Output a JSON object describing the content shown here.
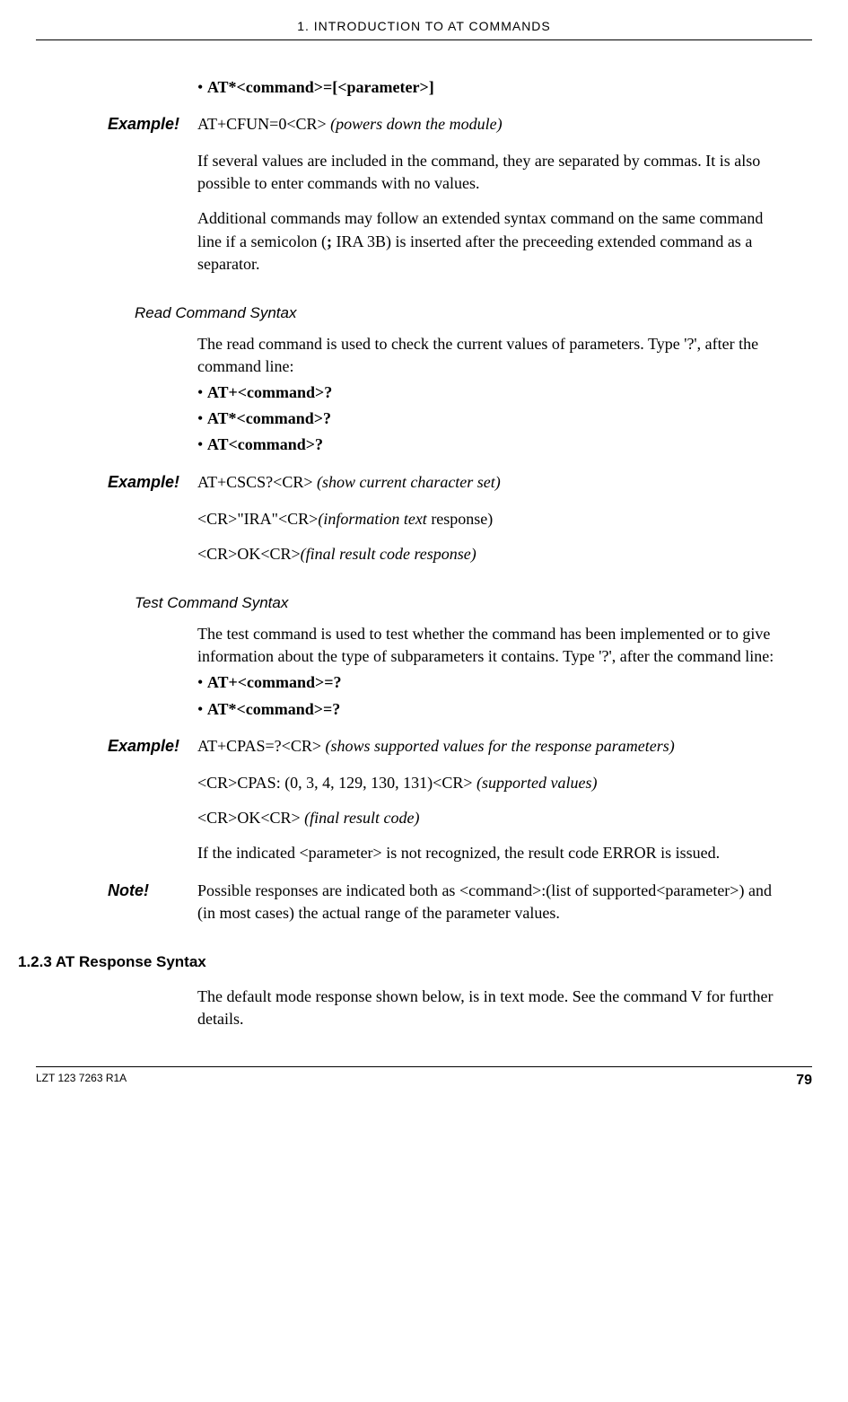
{
  "header": {
    "title": "1. INTRODUCTION TO AT COMMANDS"
  },
  "top_bullet": "AT*<command>=[<parameter>]",
  "ex1": {
    "label": "Example!",
    "cmd": "AT+CFUN=0<CR> ",
    "note": "(powers down the module)"
  },
  "p1": "If several values are included in the command, they are separated by commas. It is also possible to enter commands with no values.",
  "p2a": "Additional commands may follow an extended syntax command on the same command line if a semicolon (",
  "p2b": ";",
  "p2c": " IRA 3B) is inserted after the preceeding extended command as a separator.",
  "read_heading": "Read Command Syntax",
  "read_intro": "The read command is used to check the current values of parameters. Type '?', after the command line:",
  "read_bullets": [
    "AT+<command>?",
    "AT*<command>?",
    "AT<command>?"
  ],
  "ex2": {
    "label": "Example!",
    "cmd": "AT+CSCS?<CR> ",
    "note": "(show current character set)"
  },
  "ex2_r1a": "<CR>\"IRA\"<CR>",
  "ex2_r1b": "(information text ",
  "ex2_r1c": "response)",
  "ex2_r2a": "<CR>OK<CR>",
  "ex2_r2b": "(final result code response)",
  "test_heading": "Test Command Syntax",
  "test_intro": "The test command is used to test whether the command has been implemented or to give information about the type of subparameters it contains. Type '?', after the command line:",
  "test_bullets": [
    "AT+<command>=?",
    "AT*<command>=?"
  ],
  "ex3": {
    "label": "Example!",
    "cmd": "AT+CPAS=?<CR> ",
    "note": "(shows supported values for the response parameters)"
  },
  "ex3_r1a": "<CR>CPAS: (0, 3, 4, 129, 130, 131)<CR> ",
  "ex3_r1b": "(supported values)",
  "ex3_r2a": "<CR>OK<CR> ",
  "ex3_r2b": "(final result code)",
  "ex3_p": "If the indicated <parameter> is not recognized, the result code ERROR is issued.",
  "note1": {
    "label": "Note!",
    "text": "Possible responses are indicated both as <command>:(list of supported<parameter>) and (in most cases) the actual range of the parameter values."
  },
  "sec_heading": "1.2.3 AT Response Syntax",
  "sec_p": "The default mode response shown below, is in text mode. See the command V for further details.",
  "footer": {
    "left": "LZT 123 7263 R1A",
    "right": "79"
  }
}
